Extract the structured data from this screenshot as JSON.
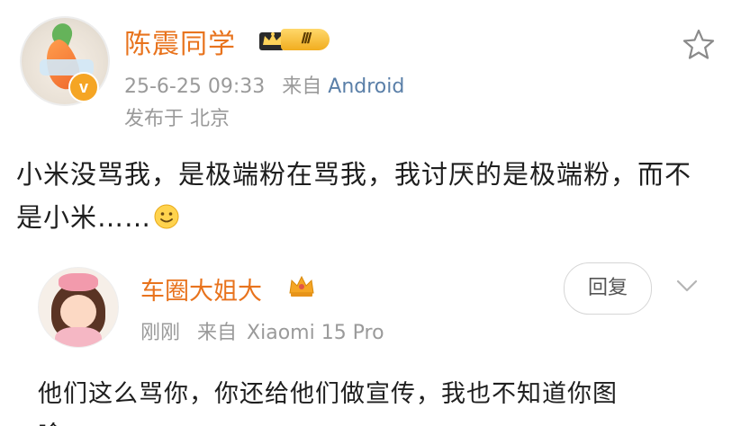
{
  "post": {
    "username": "陈震同学",
    "level_badge": "Ⅲ",
    "verified_mark": "v",
    "timestamp": "25-6-25 09:33",
    "source_prefix": "来自",
    "source": "Android",
    "location": "发布于 北京",
    "body": "小米没骂我，是极端粉在骂我，我讨厌的是极端粉，而不是小米……"
  },
  "comment": {
    "username": "车圈大姐大",
    "time": "刚刚",
    "source_prefix": "来自",
    "source": "Xiaomi 15 Pro",
    "reply_label": "回复",
    "body": "他们这么骂你，你还给他们做宣传，我也不知道你图",
    "body_tail": "啥"
  },
  "icons": {
    "favorite": "star-icon",
    "expand": "chevron-down-icon",
    "emoji": "smile-icon",
    "badge": "crown-icon"
  },
  "colors": {
    "username": "#e8731d",
    "meta": "#9a9a9a",
    "source_link": "#5a7fa8",
    "badge_gold": "#f1ad1f"
  }
}
